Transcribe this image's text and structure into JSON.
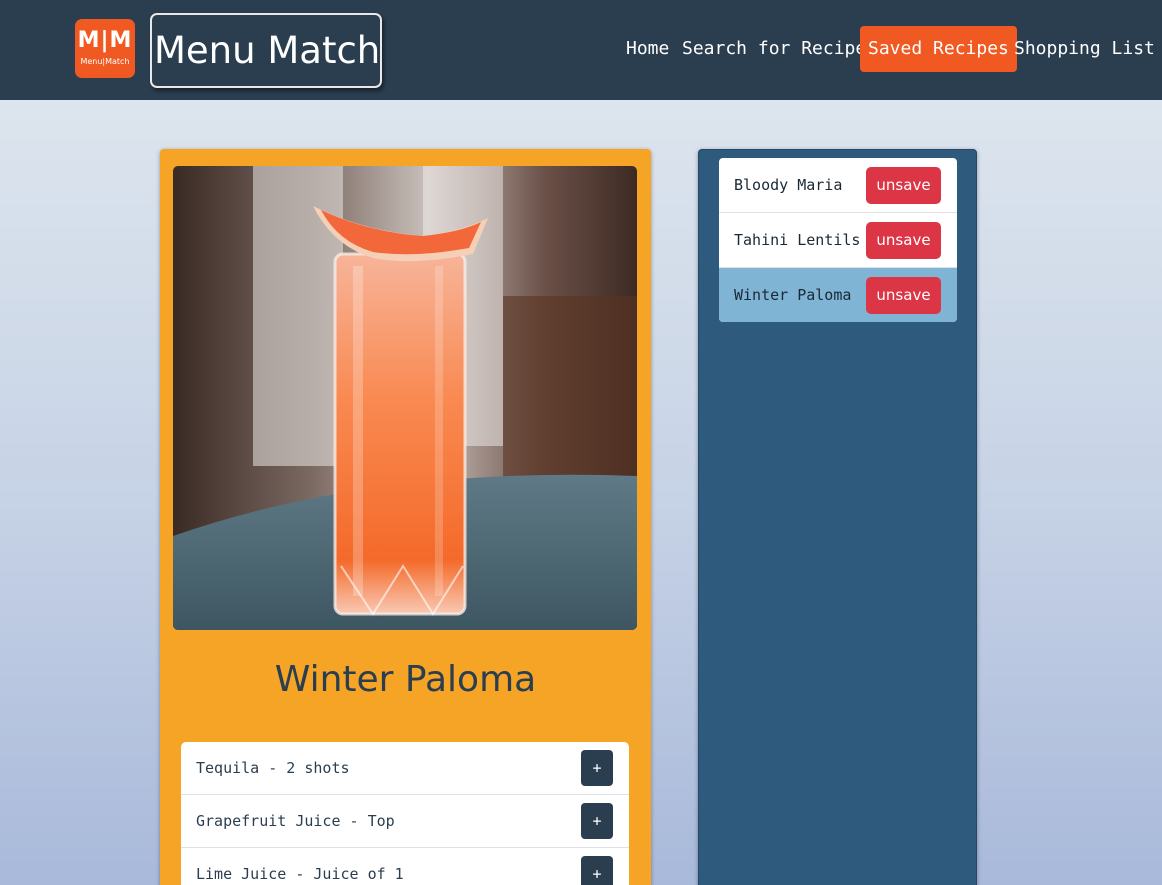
{
  "header": {
    "logo_mark": "M|M",
    "logo_sub": "Menu|Match",
    "brand": "Menu Match",
    "nav": [
      {
        "label": "Home"
      },
      {
        "label": "Search for Recipe"
      },
      {
        "label": "Saved Recipes",
        "active": true
      },
      {
        "label": "Shopping List"
      }
    ]
  },
  "recipe": {
    "image_alt": "Winter Paloma cocktail with grapefruit garnish",
    "title": "Winter Paloma",
    "ingredients": [
      {
        "text": "Tequila - 2 shots",
        "button": "+"
      },
      {
        "text": "Grapefruit Juice - Top",
        "button": "+"
      },
      {
        "text": "Lime Juice - Juice of 1",
        "button": "+"
      }
    ]
  },
  "saved": {
    "items": [
      {
        "name": "Bloody Maria",
        "button": "unsave"
      },
      {
        "name": "Tahini Lentils",
        "button": "unsave"
      },
      {
        "name": "Winter Paloma",
        "button": "unsave",
        "active": true
      }
    ]
  },
  "colors": {
    "navbar": "#2b3e50",
    "accent": "#f05a22",
    "card": "#f5a426",
    "panel": "#2d5a7d",
    "danger": "#dc3545",
    "active_row": "#7fb4d4"
  }
}
